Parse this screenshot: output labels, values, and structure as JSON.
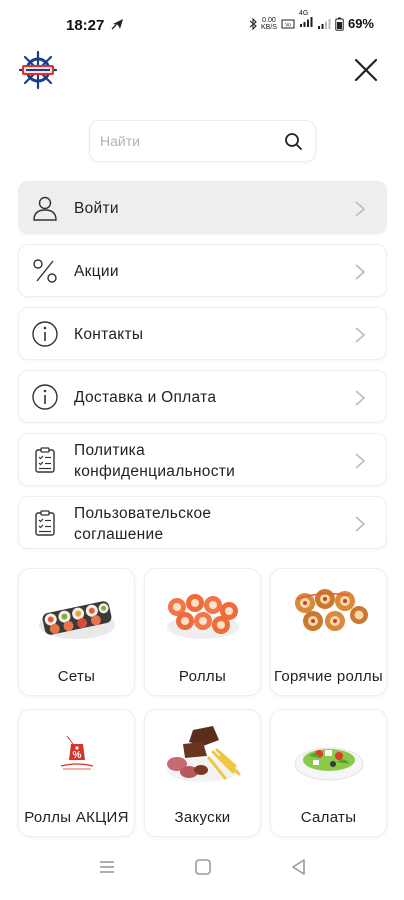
{
  "status_bar": {
    "time": "18:27",
    "network_speed": "0.00\nKB/S",
    "network_type": "4G",
    "battery": "69%"
  },
  "header": {
    "logo_icon": "ship-wheel-logo",
    "close_icon": "close-icon"
  },
  "search": {
    "placeholder": "Найти",
    "value": ""
  },
  "menu": {
    "items": [
      {
        "label": "Войти",
        "icon": "user-icon",
        "active": true
      },
      {
        "label": "Акции",
        "icon": "percent-icon",
        "active": false
      },
      {
        "label": "Контакты",
        "icon": "info-icon",
        "active": false
      },
      {
        "label": "Доставка и Оплата",
        "icon": "info-icon",
        "active": false
      },
      {
        "label": "Политика\nконфиденциальности",
        "icon": "clipboard-icon",
        "active": false
      },
      {
        "label": "Пользовательское\nсоглашение",
        "icon": "clipboard-icon",
        "active": false
      }
    ]
  },
  "categories": [
    {
      "label": "Сеты"
    },
    {
      "label": "Роллы"
    },
    {
      "label": "Горячие роллы"
    },
    {
      "label": "Роллы АКЦИЯ"
    },
    {
      "label": "Закуски"
    },
    {
      "label": "Салаты"
    }
  ],
  "colors": {
    "accent_red": "#d8322a",
    "active_bg": "#eeeeee",
    "border": "#eeeeee"
  }
}
